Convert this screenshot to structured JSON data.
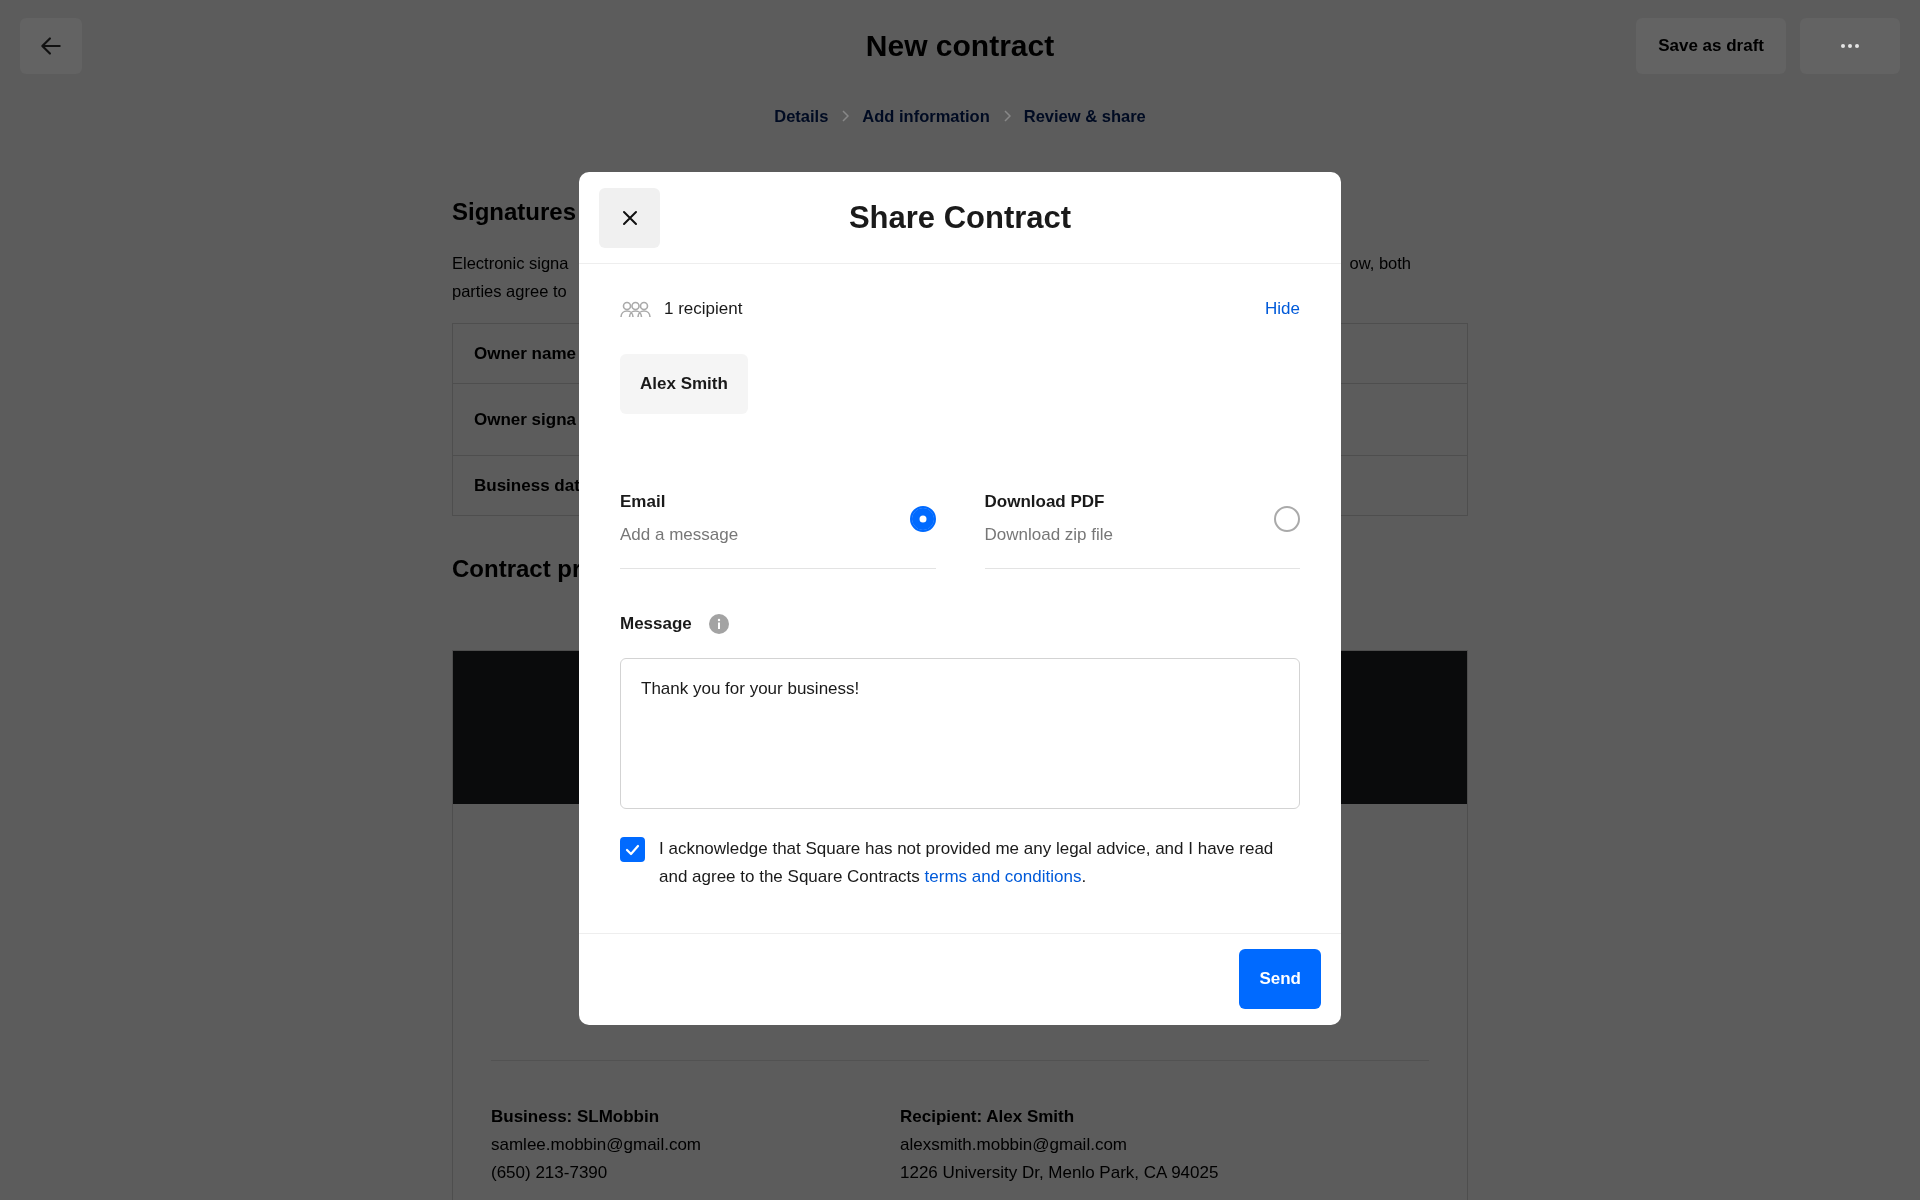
{
  "page": {
    "title": "New contract",
    "actions": [
      {
        "label": "Save as draft",
        "kind": "text"
      },
      {
        "kind": "more"
      }
    ],
    "breadcrumbs": [
      {
        "label": "Details"
      },
      {
        "label": "Add information"
      },
      {
        "label": "Review & share"
      }
    ],
    "signatures": {
      "title": "Signatures",
      "description_left": [
        "Electronic signa",
        "parties agree to"
      ],
      "description_right": [
        "ow, both"
      ],
      "rows": [
        "Owner name",
        "Owner signa",
        "Business dat"
      ]
    },
    "preview": {
      "title": "Contract pr",
      "business": {
        "heading": "Business: SLMobbin",
        "lines": [
          "samlee.mobbin@gmail.com",
          "(650) 213-7390"
        ]
      },
      "recipient": {
        "heading": "Recipient: Alex Smith",
        "lines": [
          "alexsmith.mobbin@gmail.com",
          "1226 University Dr, Menlo Park, CA 94025"
        ]
      }
    }
  },
  "dialog": {
    "title": "Share Contract",
    "recipient_count": "1 recipient",
    "hide_link": "Hide",
    "recipients": [
      "Alex Smith"
    ],
    "delivery_options": [
      {
        "label": "Email",
        "description": "Add a message",
        "selected": true
      },
      {
        "label": "Download PDF",
        "description": "Download zip file",
        "selected": false
      }
    ],
    "message": {
      "label": "Message",
      "value": "Thank you for your business!"
    },
    "acknowledgement": {
      "checked": true,
      "text": "I acknowledge that Square has not provided me any legal advice, and I have read and agree to the Square Contracts ",
      "link": "terms and conditions",
      "suffix": "."
    },
    "send_button": "Send"
  }
}
